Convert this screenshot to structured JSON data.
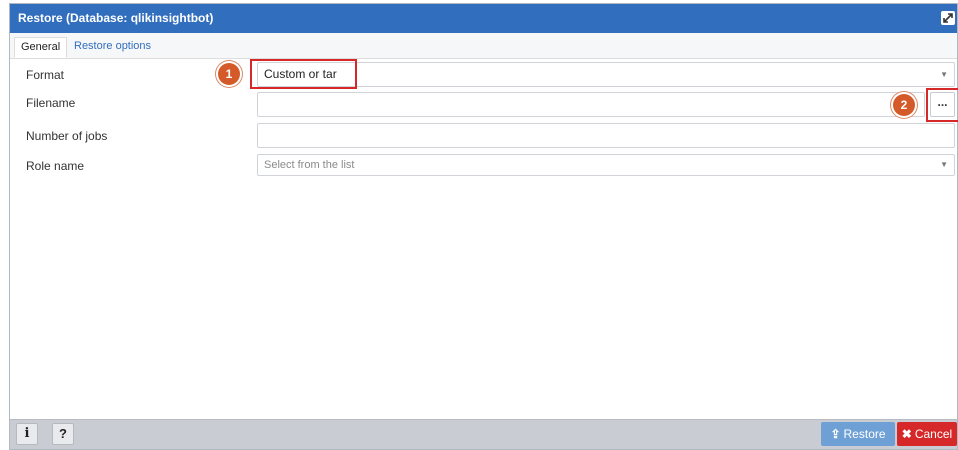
{
  "window": {
    "title": "Restore (Database: qlikinsightbot)"
  },
  "tabs": [
    {
      "label": "General"
    },
    {
      "label": "Restore options"
    }
  ],
  "form": {
    "format": {
      "label": "Format",
      "value": "Custom or tar"
    },
    "filename": {
      "label": "Filename",
      "value": ""
    },
    "jobs": {
      "label": "Number of jobs",
      "value": ""
    },
    "role": {
      "label": "Role name",
      "placeholder": "Select from the list"
    }
  },
  "annotations": {
    "badge1": "1",
    "badge2": "2"
  },
  "browse": {
    "label": "..."
  },
  "footer": {
    "info_label": "i",
    "help_label": "?",
    "restore_label": "Restore",
    "cancel_label": "Cancel"
  },
  "colors": {
    "titlebar": "#326ebe",
    "highlight": "#d62828",
    "badge": "#d45a2a",
    "restore": "#6ea0d6",
    "cancel": "#d62828"
  },
  "icons": {
    "maximize": "maximize-icon",
    "restore": "upload-icon",
    "cancel": "x-icon",
    "dropdown": "caret-down-icon"
  }
}
